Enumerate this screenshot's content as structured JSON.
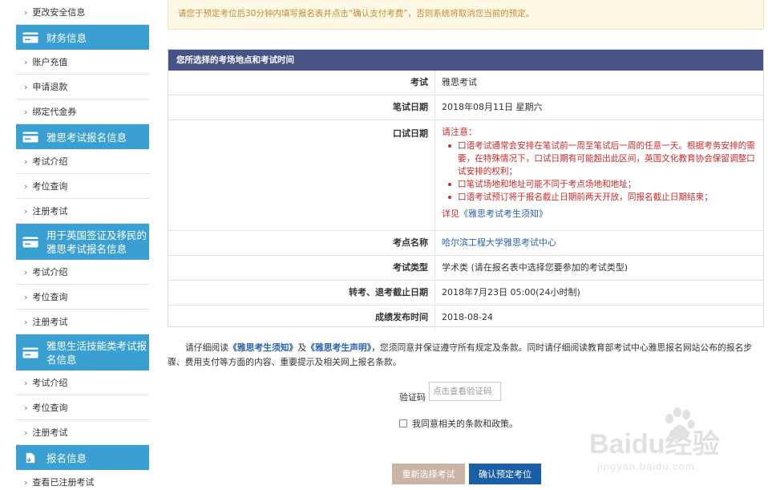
{
  "notice": "请您于预定考位后30分钟内填写报名表并点击“确认支付考费”，否则系统将取消您当前的预定。",
  "sidebar": {
    "top_item": "更改安全信息",
    "sections": [
      {
        "title": "财务信息",
        "items": [
          "账户充值",
          "申请退款",
          "绑定代金券"
        ]
      },
      {
        "title": "雅思考试报名信息",
        "items": [
          "考试介绍",
          "考位查询",
          "注册考试"
        ]
      },
      {
        "title": "用于英国签证及移民的雅思考试报名信息",
        "items": [
          "考试介绍",
          "考位查询",
          "注册考试"
        ]
      },
      {
        "title": "雅思生活技能类考试报名信息",
        "items": [
          "考试介绍",
          "考位查询",
          "注册考试"
        ]
      },
      {
        "title": "报名信息",
        "items": [
          "查看已注册考试"
        ]
      }
    ]
  },
  "panel": {
    "title": "您所选择的考场地点和考试时间",
    "exam_label": "考试",
    "exam_value": "雅思考试",
    "written_label": "笔试日期",
    "written_value": "2018年08月11日 星期六",
    "oral_label": "口试日期",
    "oral_note_title": "请注意：",
    "oral_notes": [
      "口语考试通常会安排在笔试前一周至笔试后一周的任意一天。根据考务安排的需要，在特殊情况下，口试日期有可能超出此区间，英国文化教育协会保留调整口试安排的权利；",
      "口笔试场地和地址可能不同于考点场地和地址；",
      "口语考试预订将于报名截止日期前两天开放，同报名截止日期结束；"
    ],
    "oral_see_prefix": "详见",
    "oral_see_link": "《雅思考试考生须知》",
    "center_label": "考点名称",
    "center_value": "哈尔滨工程大学雅思考试中心",
    "type_label": "考试类型",
    "type_value": "学术类 (请在报名表中选择您要参加的考试类型)",
    "deadline_label": "转考、退考截止日期",
    "deadline_value": "2018年7月23日 05:00(24小时制)",
    "result_label": "成绩发布时间",
    "result_value": "2018-08-24"
  },
  "agreement": {
    "part1": "请仔细阅读",
    "link1": "《雅思考生须知》",
    "part2": "及",
    "link2": "《雅思考生声明》",
    "part3": "，您须同意并保证遵守所有规定及条款。同时请仔细阅读教育部考试中心雅思报名网站公布的报名步骤、费用支付等方面的内容、重要提示及相关网上报名条款。"
  },
  "captcha": {
    "label": "验证码",
    "placeholder": "点击查看验证码"
  },
  "agree_checkbox": "我同意相关的条款和政策。",
  "buttons": {
    "reselect": "重新选择考试",
    "confirm": "确认预定考位"
  },
  "watermark": {
    "brand": "Baidu经验",
    "sub": "jingyan.baidu.com"
  },
  "colors": {
    "header_blue": "#3a9fd1",
    "panel_head": "#475287",
    "confirm_btn": "#1a5ea8",
    "reselect_btn": "#c9b4a5",
    "alert_red": "#cc2929",
    "link_blue": "#2a62b0"
  }
}
